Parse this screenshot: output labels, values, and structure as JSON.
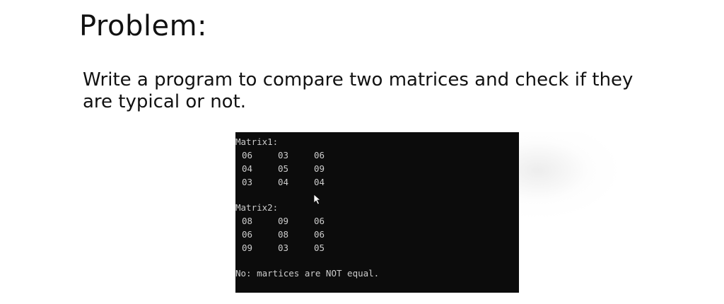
{
  "slide": {
    "title": "Problem:",
    "body_lines": [
      "Write a program to compare two matrices and check if they",
      "are typical or not."
    ]
  },
  "console": {
    "matrix1_label": "Matrix1:",
    "matrix1": [
      [
        "06",
        "03",
        "06"
      ],
      [
        "04",
        "05",
        "09"
      ],
      [
        "03",
        "04",
        "04"
      ]
    ],
    "matrix2_label": "Matrix2:",
    "matrix2": [
      [
        "08",
        "09",
        "06"
      ],
      [
        "06",
        "08",
        "06"
      ],
      [
        "09",
        "03",
        "05"
      ]
    ],
    "result": "No: martices are NOT equal.",
    "colors": {
      "background": "#0c0c0c",
      "text": "#cccccc"
    }
  },
  "icons": {
    "cursor": "mouse-pointer-icon"
  }
}
